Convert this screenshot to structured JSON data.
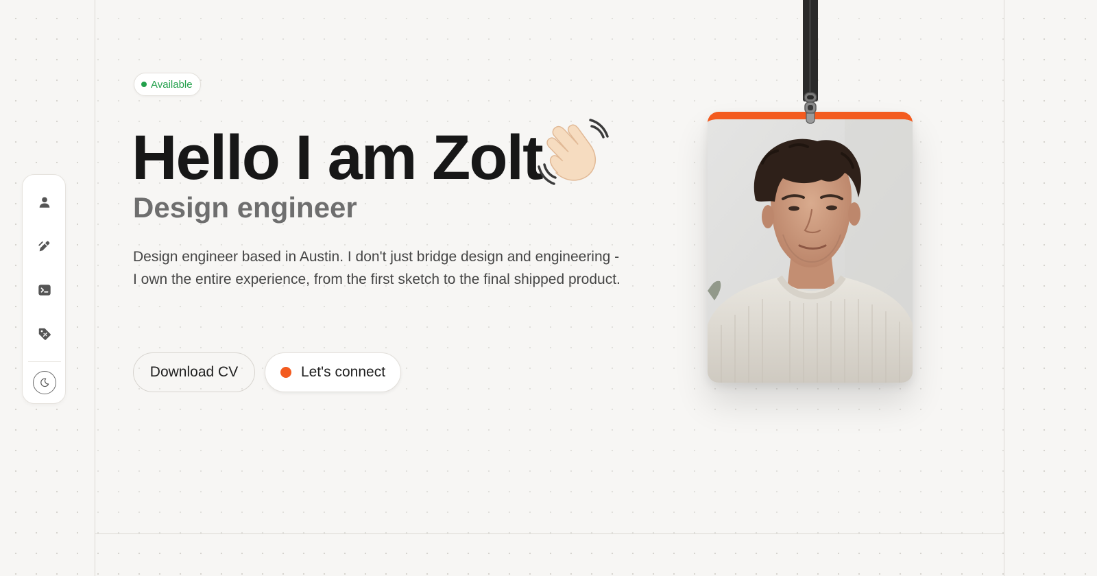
{
  "status_badge": {
    "label": "Available",
    "color": "#22a04b"
  },
  "hero": {
    "headline": "Hello I am Zolt",
    "subtitle": "Design engineer",
    "description": "Design engineer based in Austin. I don't just bridge design and engineering - I own the entire experience, from the first sketch to the final shipped product."
  },
  "buttons": {
    "download_cv": "Download CV",
    "connect": "Let's connect"
  },
  "sidebar": {
    "items": [
      {
        "icon": "user-icon"
      },
      {
        "icon": "pen-icon"
      },
      {
        "icon": "terminal-icon"
      },
      {
        "icon": "tag-icon"
      }
    ],
    "theme_toggle": {
      "icon": "moon-icon"
    }
  },
  "colors": {
    "accent": "#f35b1f",
    "available_green": "#22a04b",
    "background": "#f7f6f4",
    "text": "#171717"
  },
  "profile_photo": {
    "description": "portrait-photo"
  }
}
